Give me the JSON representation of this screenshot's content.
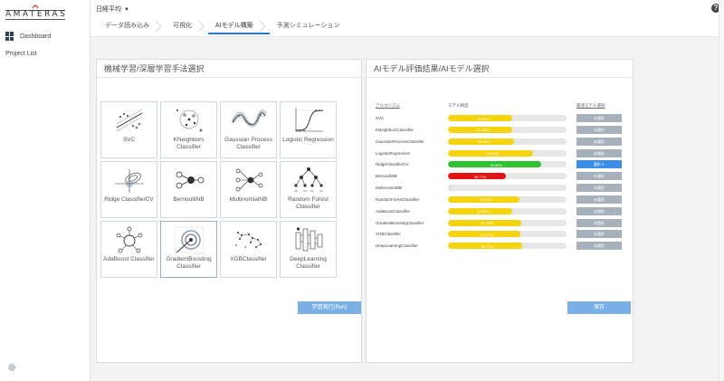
{
  "app": {
    "logo_text": "AMATERAS"
  },
  "sidebar": {
    "items": [
      {
        "label": "Dashboard",
        "icon": "dashboard-icon"
      },
      {
        "label": "Project List"
      }
    ],
    "settings_icon": "gear-icon"
  },
  "header": {
    "dataset": "日経平均",
    "steps": [
      {
        "label": "データ読み込み",
        "active": false
      },
      {
        "label": "可視化",
        "active": false
      },
      {
        "label": "AIモデル構築",
        "active": true
      },
      {
        "label": "予測シミュレーション",
        "active": false
      }
    ],
    "help_icon": "question-icon",
    "help_label": "?"
  },
  "left_panel": {
    "title": "機械学習/深層学習手法選択",
    "algorithms": [
      {
        "label": "SVC",
        "icon": "svc-icon"
      },
      {
        "label": "KNeighbors Classifier",
        "icon": "kneighbors-icon"
      },
      {
        "label": "Gaussian Process Classifier",
        "icon": "gaussian-process-icon"
      },
      {
        "label": "Logistic Regression",
        "icon": "logistic-regression-icon"
      },
      {
        "label": "Ridge ClassifierCV",
        "icon": "ridge-icon"
      },
      {
        "label": "BernoulliNB",
        "icon": "bernoulli-icon"
      },
      {
        "label": "MultinomialNB",
        "icon": "multinomial-icon"
      },
      {
        "label": "Random Forest Classifier",
        "icon": "random-forest-icon"
      },
      {
        "label": "AdaBoost Classifier",
        "icon": "adaboost-icon"
      },
      {
        "label": "GradientBoosting Classifier",
        "icon": "gradient-boosting-icon"
      },
      {
        "label": "XGBClassifier",
        "icon": "xgb-icon"
      },
      {
        "label": "DeepLearning Classifier",
        "icon": "deep-learning-icon"
      }
    ],
    "run_button": "学習実行(Run)"
  },
  "right_panel": {
    "title": "AIモデル評価結果/AIモデル選択",
    "col_algorithm": "アルゴリズム",
    "col_score": "モデル精度",
    "col_select": "最適モデル選択",
    "results": [
      {
        "name": "SVC",
        "score_text": "53.96%",
        "score": 53.96,
        "status": "yellow",
        "button": "未選択",
        "selected": false
      },
      {
        "name": "KNeighborsClassifier",
        "score_text": "53.96%",
        "score": 53.96,
        "status": "yellow",
        "button": "未選択",
        "selected": false
      },
      {
        "name": "GaussianProcessClassifier",
        "score_text": "56.02%",
        "score": 56.02,
        "status": "yellow",
        "button": "未選択",
        "selected": false
      },
      {
        "name": "LogisticRegression",
        "score_text": "72.09%",
        "score": 72.09,
        "status": "yellow",
        "button": "未選択",
        "selected": false
      },
      {
        "name": "RidgeClassifierCV",
        "score_text": "78.60%",
        "score": 78.6,
        "status": "green",
        "button": "選択 ✔",
        "selected": true
      },
      {
        "name": "BernoulliNB",
        "score_text": "48.77%",
        "score": 48.77,
        "status": "red",
        "button": "未選択",
        "selected": false
      },
      {
        "name": "MultinomialNB",
        "score_text": "",
        "score": 3,
        "status": "grey",
        "button": "未選択",
        "selected": false
      },
      {
        "name": "RandomForestClassifier",
        "score_text": "60.59%",
        "score": 60.59,
        "status": "yellow",
        "button": "未選択",
        "selected": false
      },
      {
        "name": "AdaBoostClassifier",
        "score_text": "54.03%",
        "score": 54.03,
        "status": "yellow",
        "button": "未選択",
        "selected": false
      },
      {
        "name": "GradientBoostingClassifier",
        "score_text": "61.73%",
        "score": 61.73,
        "status": "yellow",
        "button": "未選択",
        "selected": false
      },
      {
        "name": "XGBClassifier",
        "score_text": "61.17%",
        "score": 61.17,
        "status": "yellow",
        "button": "未選択",
        "selected": false
      },
      {
        "name": "DeepLearningClassifier",
        "score_text": "62.77%",
        "score": 62.77,
        "status": "yellow",
        "button": "未選択",
        "selected": false
      }
    ],
    "save_button": "保存"
  },
  "colors": {
    "yellow": "#f5d40f",
    "green": "#2fc12f",
    "red": "#e31414",
    "grey": "#e0e0e0",
    "accent": "#3b8ee8"
  }
}
